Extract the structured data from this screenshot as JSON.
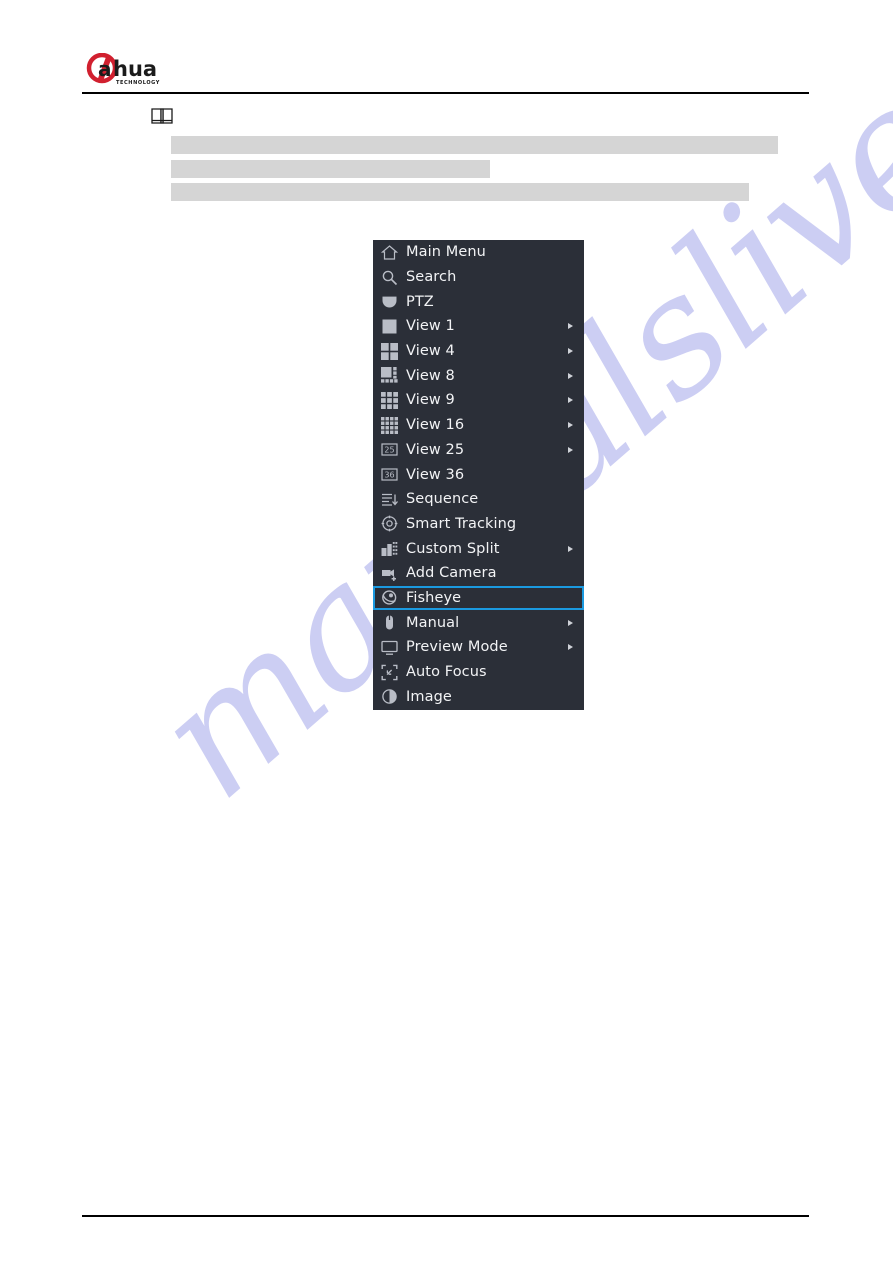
{
  "document": {
    "logo": {
      "brand": "alhua",
      "tagline": "TECHNOLOGY",
      "brand_color": "#d1202f",
      "text_color": "#1b1b1b"
    },
    "note_icon_name": "note-book-icon",
    "redacted_bars": [
      {
        "label": "redacted-line-1"
      },
      {
        "label": "redacted-line-2"
      },
      {
        "label": "redacted-line-3"
      }
    ],
    "watermark": "manualslive.com"
  },
  "context_menu": {
    "background_color": "#2b2f38",
    "highlight_color": "#1b9ae0",
    "text_color": "#f2f3f5",
    "items": [
      {
        "label": "Main Menu",
        "icon": "home-icon",
        "arrow": false,
        "selected": false
      },
      {
        "label": "Search",
        "icon": "search-icon",
        "arrow": false,
        "selected": false
      },
      {
        "label": "PTZ",
        "icon": "ptz-dome-icon",
        "arrow": false,
        "selected": false
      },
      {
        "label": "View 1",
        "icon": "view-1-grid-icon",
        "arrow": true,
        "selected": false
      },
      {
        "label": "View 4",
        "icon": "view-4-grid-icon",
        "arrow": true,
        "selected": false
      },
      {
        "label": "View 8",
        "icon": "view-8-grid-icon",
        "arrow": true,
        "selected": false
      },
      {
        "label": "View 9",
        "icon": "view-9-grid-icon",
        "arrow": true,
        "selected": false
      },
      {
        "label": "View 16",
        "icon": "view-16-grid-icon",
        "arrow": true,
        "selected": false
      },
      {
        "label": "View 25",
        "icon": "view-25-badge-icon",
        "arrow": true,
        "selected": false
      },
      {
        "label": "View 36",
        "icon": "view-36-badge-icon",
        "arrow": false,
        "selected": false
      },
      {
        "label": "Sequence",
        "icon": "sequence-icon",
        "arrow": false,
        "selected": false
      },
      {
        "label": "Smart Tracking",
        "icon": "smart-tracking-icon",
        "arrow": false,
        "selected": false
      },
      {
        "label": "Custom Split",
        "icon": "custom-split-icon",
        "arrow": true,
        "selected": false
      },
      {
        "label": "Add Camera",
        "icon": "add-camera-icon",
        "arrow": false,
        "selected": false
      },
      {
        "label": "Fisheye",
        "icon": "fisheye-icon",
        "arrow": false,
        "selected": true
      },
      {
        "label": "Manual",
        "icon": "mouse-icon",
        "arrow": true,
        "selected": false
      },
      {
        "label": "Preview Mode",
        "icon": "monitor-icon",
        "arrow": true,
        "selected": false
      },
      {
        "label": "Auto Focus",
        "icon": "auto-focus-icon",
        "arrow": false,
        "selected": false
      },
      {
        "label": "Image",
        "icon": "image-icon",
        "arrow": false,
        "selected": false
      }
    ],
    "badge_labels": {
      "view_25": "25",
      "view_36": "36"
    }
  }
}
